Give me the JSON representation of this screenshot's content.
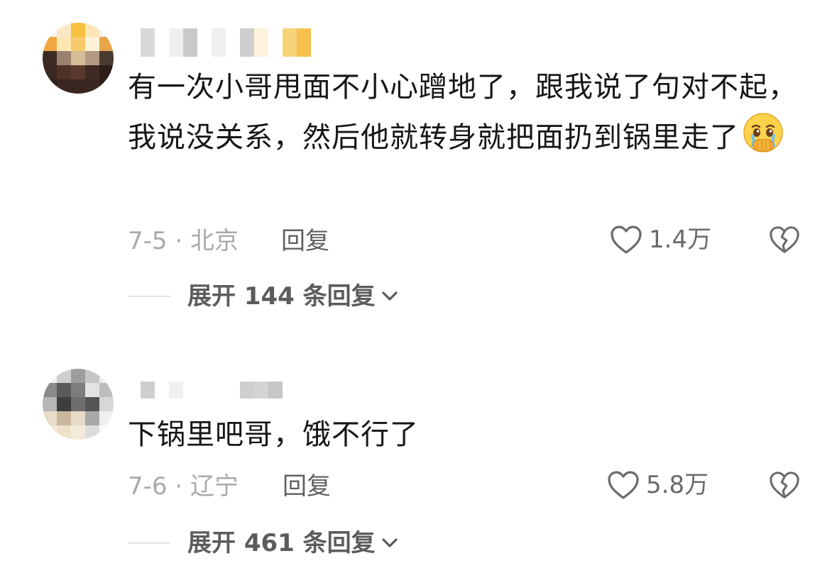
{
  "comments": [
    {
      "text": "有一次小哥甩面不小心蹭地了，跟我说了句对不起，我说没关系，然后他就转身就把面扔到锅里走了",
      "emoji": "face-holding-back-tears-icon",
      "date": "7-5 · 北京",
      "reply_label": "回复",
      "likes": "1.4万",
      "expand_label": "展开 144 条回复"
    },
    {
      "text": "下锅里吧哥，饿不行了",
      "date": "7-6 · 辽宁",
      "reply_label": "回复",
      "likes": "5.8万",
      "expand_label": "展开 461 条回复"
    }
  ],
  "colors": {
    "text": "#161616",
    "meta": "#a9a9a9",
    "action": "#5f5f5f"
  }
}
